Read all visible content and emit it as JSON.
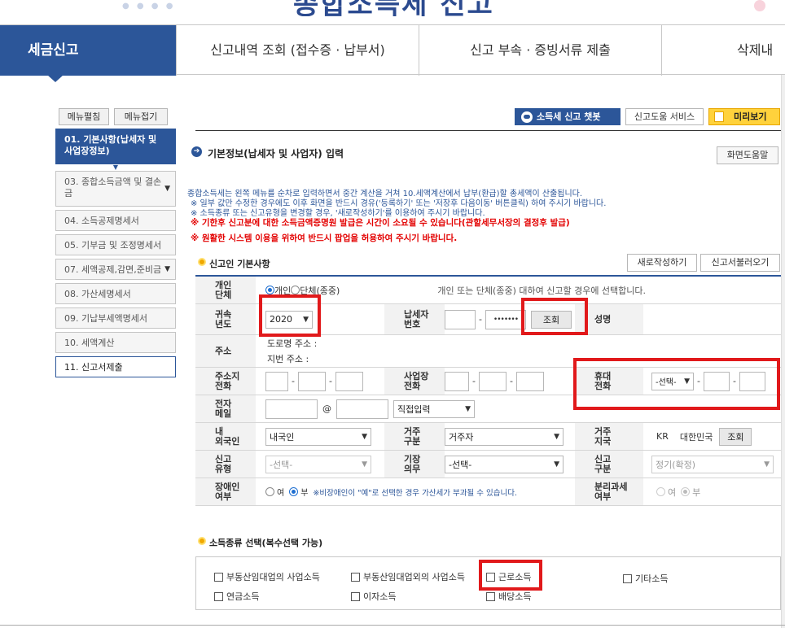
{
  "banner": {
    "title": "종합소득세 신고"
  },
  "tabs": {
    "active": "세금신고",
    "items": [
      "신고내역 조회 (접수증 · 납부서)",
      "신고 부속 · 증빙서류 제출",
      "삭제내"
    ]
  },
  "sidebar": {
    "expand_all": "메뉴펼침",
    "collapse_all": "메뉴접기",
    "items": [
      "01. 기본사항(납세자 및 사업장정보)",
      "03. 종합소득금액 및 결손금",
      "04. 소득공제명세서",
      "05. 기부금 및 조정명세서",
      "07. 세액공제,감면,준비금",
      "08. 가산세명세서",
      "09. 기납부세액명세서",
      "10. 세액계산",
      "11. 신고서제출"
    ]
  },
  "toolbar": {
    "chatbot": "소득세 신고 챗봇",
    "help_service": "신고도움 서비스",
    "preview": "미리보기",
    "screen_help": "화면도움말"
  },
  "section": {
    "title": "기본정보(납세자 및 사업자) 입력",
    "notice_1": "종합소득세는 왼쪽 메뉴를 순차로 입력하면서 중간 계산을 거쳐 10.세액계산에서 납부(환급)할 총세액이 산출됩니다.",
    "notice_2": "※ 일부 값만 수정한 경우에도 이후 화면을 반드시 경유('등록하기' 또는 '저장후 다음이동' 버튼클릭) 하여 주시기 바랍니다.",
    "notice_3": "※ 소득종류 또는 신고유형을 변경할 경우, '새로작성하기'를 이용하여 주시기 바랍니다.",
    "notice_4": "※ 기한후 신고분에 대한 소득금액증명원 발급은 시간이 소요될 수 있습니다(관할세무서장의 결정후 발급)",
    "notice_5": "※ 원활한 시스템 이용을 위하여 반드시 팝업을 허용하여 주시기 바랍니다."
  },
  "reporter": {
    "title": "신고인 기본사항",
    "btn_new": "새로작성하기",
    "btn_load": "신고서불러오기",
    "type_label": "개인\n단체",
    "type_opt_individual": "개인",
    "type_opt_group": "단체(종중)",
    "type_help": "개인 또는 단체(종중) 대하여 신고할 경우에 선택합니다.",
    "year_label": "귀속\n년도",
    "year_value": "2020",
    "taxpayer_no_label": "납세자\n번호",
    "taxpayer_no_mask": "•••••••",
    "lookup": "조회",
    "name_label": "성명",
    "address_label": "주소",
    "road_address": "도로명 주소 :",
    "lot_address": "지번 주소 :",
    "home_phone_label": "주소지\n전화",
    "biz_phone_label": "사업장\n전화",
    "mobile_label": "휴대\n전화",
    "mobile_select": "-선택-",
    "email_label": "전자\n메일",
    "email_at": "@",
    "email_domain": "직접입력",
    "nationality_label": "내\n외국인",
    "nationality_value": "내국인",
    "residence_label": "거주\n구분",
    "residence_value": "거주자",
    "residence_country_label": "거주\n지국",
    "country_code": "KR",
    "country_name": "대한민국",
    "country_lookup": "조회",
    "report_type_label": "신고\n유형",
    "report_type_value": "-선택-",
    "bookkeeping_label": "기장\n의무",
    "bookkeeping_value": "-선택-",
    "report_class_label": "신고\n구분",
    "report_class_value": "정기(확정)",
    "disabled_label": "장애인\n여부",
    "yes": "여",
    "no": "부",
    "disabled_note": "※비장애인이 \"예\"로 선택한 경우 가산세가 부과될 수 있습니다.",
    "separate_tax_label": "분리과세\n여부"
  },
  "income": {
    "title": "소득종류 선택(복수선택 가능)",
    "items": [
      "부동산임대업의 사업소득",
      "부동산임대업외의 사업소득",
      "근로소득",
      "기타소득",
      "연금소득",
      "이자소득",
      "배당소득"
    ]
  }
}
